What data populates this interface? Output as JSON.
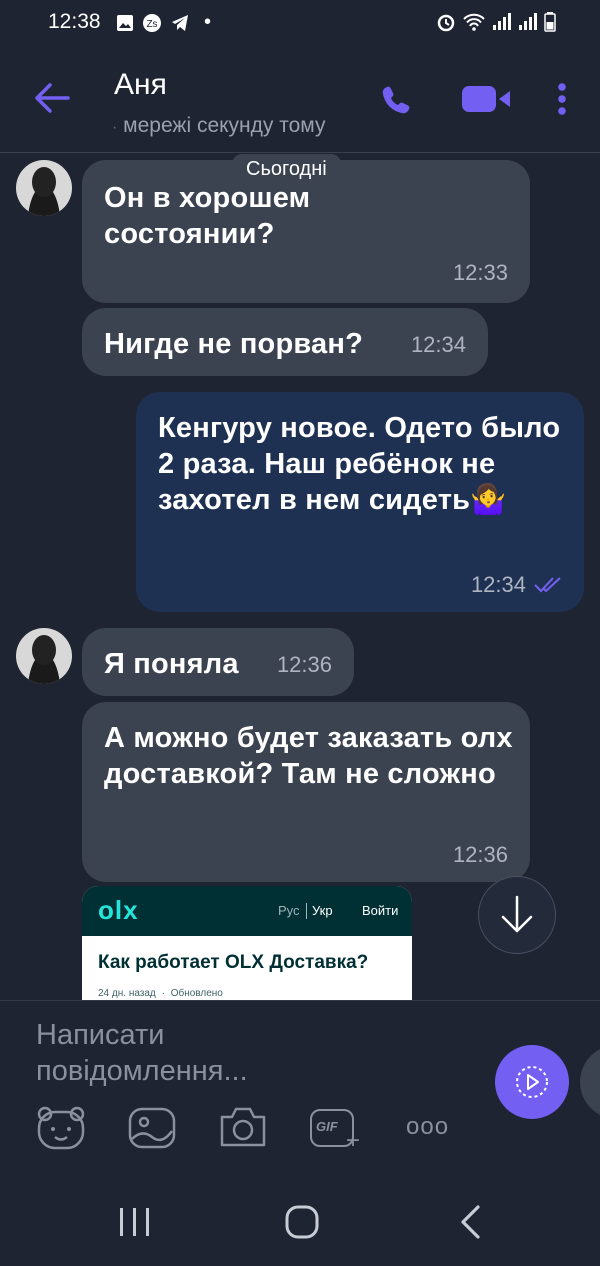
{
  "status_bar": {
    "time": "12:38",
    "dot": "•"
  },
  "header": {
    "contact_name": "Аня",
    "contact_status": "мережі секунду тому",
    "status_prefix": "·"
  },
  "date_separator": "Сьогодні",
  "messages": [
    {
      "text": "Он в хорошем состоянии?",
      "time": "12:33",
      "direction": "in"
    },
    {
      "text": "Нигде не порван?",
      "time": "12:34",
      "direction": "in"
    },
    {
      "text": "Кенгуру новое. Одето было 2 раза. Наш ребёнок не захотел в нем сидеть🤷‍♀️",
      "time": "12:34",
      "direction": "out",
      "read": true
    },
    {
      "text": "Я поняла",
      "time": "12:36",
      "direction": "in"
    },
    {
      "text": "А можно будет заказать олх доставкой? Там не сложно",
      "time": "12:36",
      "direction": "in"
    }
  ],
  "link_preview": {
    "logo": "olx",
    "lang_rus": "Рус",
    "lang_ukr": "Укр",
    "login": "Войти",
    "title": "Как работает OLX Доставка?",
    "meta_date": "24 дн. назад",
    "meta_sep": "·",
    "meta_updated": "Обновлено"
  },
  "input": {
    "placeholder_line1": "Написати",
    "placeholder_line2": "повідомлення..."
  },
  "toolbar": {
    "gif_label": "GIF",
    "more": "ooo"
  },
  "colors": {
    "accent": "#7360f2",
    "background": "#1f2433",
    "incoming_bubble": "#3b4250",
    "outgoing_bubble": "#1f3152"
  }
}
